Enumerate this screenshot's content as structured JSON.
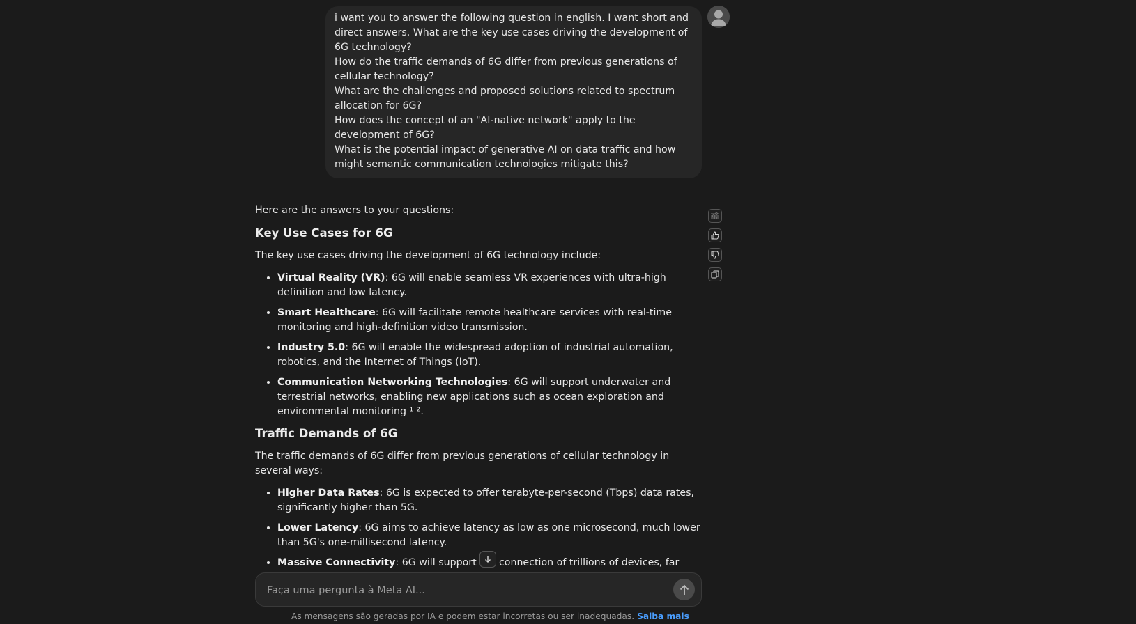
{
  "user_message": {
    "lines": [
      "i want you to answer the following question in english. I want short and direct answers. What are the key use cases driving the development of 6G technology?",
      "How do the traffic demands of 6G differ from previous generations of cellular technology?",
      "What are the challenges and proposed solutions related to spectrum allocation for 6G?",
      "How does the concept of an \"AI-native network\" apply to the development of 6G?",
      "What is the potential impact of generative AI on data traffic and how might semantic communication technologies mitigate this?"
    ]
  },
  "assistant": {
    "intro": "Here are the answers to your questions:",
    "section1": {
      "heading": "Key Use Cases for 6G",
      "lead": "The key use cases driving the development of 6G technology include:",
      "items": [
        {
          "term": "Virtual Reality (VR)",
          "text": ": 6G will enable seamless VR experiences with ultra-high definition and low latency."
        },
        {
          "term": "Smart Healthcare",
          "text": ": 6G will facilitate remote healthcare services with real-time monitoring and high-definition video transmission."
        },
        {
          "term": "Industry 5.0",
          "text": ": 6G will enable the widespread adoption of industrial automation, robotics, and the Internet of Things (IoT)."
        },
        {
          "term": "Communication Networking Technologies",
          "text": ": 6G will support underwater and terrestrial networks, enabling new applications such as ocean exploration and environmental monitoring ¹ ²."
        }
      ]
    },
    "section2": {
      "heading": "Traffic Demands of 6G",
      "lead": "The traffic demands of 6G differ from previous generations of cellular technology in several ways:",
      "items": [
        {
          "term": "Higher Data Rates",
          "text": ": 6G is expected to offer terabyte-per-second (Tbps) data rates, significantly higher than 5G."
        },
        {
          "term": "Lower Latency",
          "text": ": 6G aims to achieve latency as low as one microsecond, much lower than 5G's one-millisecond latency."
        },
        {
          "term": "Massive Connectivity",
          "text": ": 6G will support the connection of trillions of devices, far"
        }
      ]
    }
  },
  "actions": {
    "icons": [
      "sliders-icon",
      "thumbs-up-icon",
      "thumbs-down-icon",
      "copy-icon"
    ]
  },
  "composer": {
    "placeholder": "Faça uma pergunta à Meta AI..."
  },
  "footer": {
    "disclaimer": "As mensagens são geradas por IA e podem estar incorretas ou ser inadequadas.",
    "link": "Saiba mais"
  },
  "colors": {
    "background": "#1b1b1b",
    "bubble": "#262626",
    "link": "#4a9eff"
  }
}
